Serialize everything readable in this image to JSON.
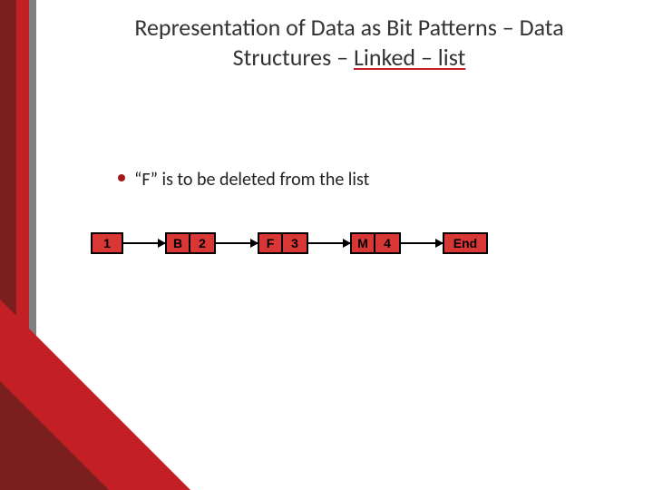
{
  "title_line1": "Representation of Data as Bit Patterns – Data",
  "title_line2_plain": "Structures – ",
  "title_line2_underlined": "Linked – list",
  "bullet_text": "“F” is to be deleted from the list",
  "list": {
    "head": "1",
    "nodes": [
      {
        "data": "B",
        "ptr": "2"
      },
      {
        "data": "F",
        "ptr": "3"
      },
      {
        "data": "M",
        "ptr": "4"
      }
    ],
    "end": "End"
  }
}
